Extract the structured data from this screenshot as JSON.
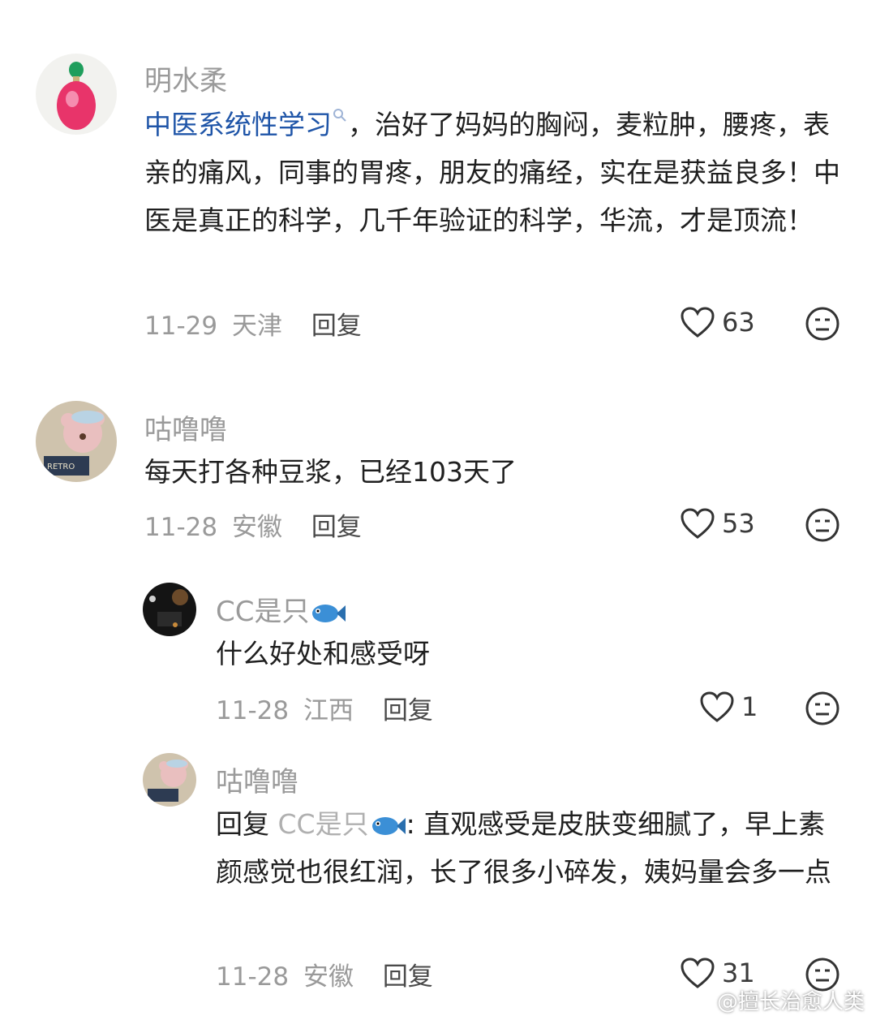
{
  "comments": [
    {
      "username": "明水柔",
      "link_text": "中医系统性学习",
      "text": "，治好了妈妈的胸闷，麦粒肿，腰疼，表亲的痛风，同事的胃疼，朋友的痛经，实在是获益良多！中医是真正的科学，几千年验证的科学，华流，才是顶流！",
      "date": "11-29",
      "location": "天津",
      "reply_label": "回复",
      "likes": "63"
    },
    {
      "username": "咕噜噜",
      "text": "每天打各种豆浆，已经103天了",
      "date": "11-28",
      "location": "安徽",
      "reply_label": "回复",
      "likes": "53"
    }
  ],
  "replies": [
    {
      "username": "CC是只",
      "username_emoji": "fish-icon",
      "text": "什么好处和感受呀",
      "date": "11-28",
      "location": "江西",
      "reply_label": "回复",
      "likes": "1"
    },
    {
      "username": "咕噜噜",
      "reply_prefix": "回复",
      "mention": "CC是只",
      "text": ": 直观感受是皮肤变细腻了，早上素颜感觉也很红润，长了很多小碎发，姨妈量会多一点",
      "date": "11-28",
      "location": "安徽",
      "reply_label": "回复",
      "likes": "31"
    }
  ],
  "watermark": "@擅长治愈人类",
  "colors": {
    "link": "#1f55a8",
    "meta": "#9a9a9a",
    "text": "#1f1f1f"
  },
  "icons": {
    "like": "heart-outline-icon",
    "dislike": "neutral-face-icon",
    "search_hint": "search-icon"
  }
}
